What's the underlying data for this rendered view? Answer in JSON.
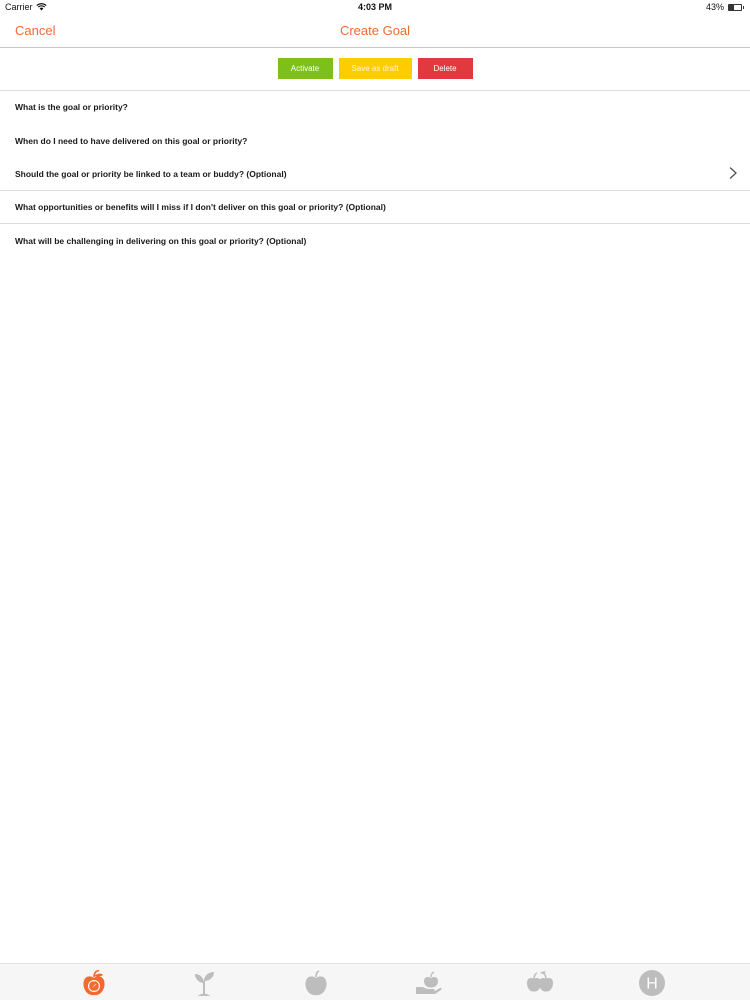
{
  "status_bar": {
    "carrier": "Carrier",
    "time": "4:03 PM",
    "battery_text": "43%",
    "battery_level": 0.43
  },
  "nav": {
    "cancel_label": "Cancel",
    "title": "Create Goal"
  },
  "actions": {
    "activate_label": "Activate",
    "draft_label": "Save as draft",
    "delete_label": "Delete"
  },
  "questions": [
    "What is the goal or priority?",
    "When do I need to have delivered on this goal or priority?",
    "Should the goal or priority be linked to a team or buddy? (Optional)",
    "What opportunities or benefits will I miss if I don't deliver on this goal or priority? (Optional)",
    "What will be challenging in delivering on this goal or priority? (Optional)"
  ],
  "tabs": [
    {
      "icon": "apple-compass-icon",
      "active": true
    },
    {
      "icon": "sprout-icon",
      "active": false
    },
    {
      "icon": "apple-icon",
      "active": false
    },
    {
      "icon": "hand-apple-icon",
      "active": false
    },
    {
      "icon": "fruit-basket-icon",
      "active": false
    },
    {
      "icon": "help-h-icon",
      "active": false,
      "text": "H"
    }
  ],
  "colors": {
    "accent": "#f26a2e",
    "activate": "#7dc01a",
    "draft": "#ffcc00",
    "delete": "#e03a3e",
    "tab_inactive": "#bdbdbd"
  }
}
